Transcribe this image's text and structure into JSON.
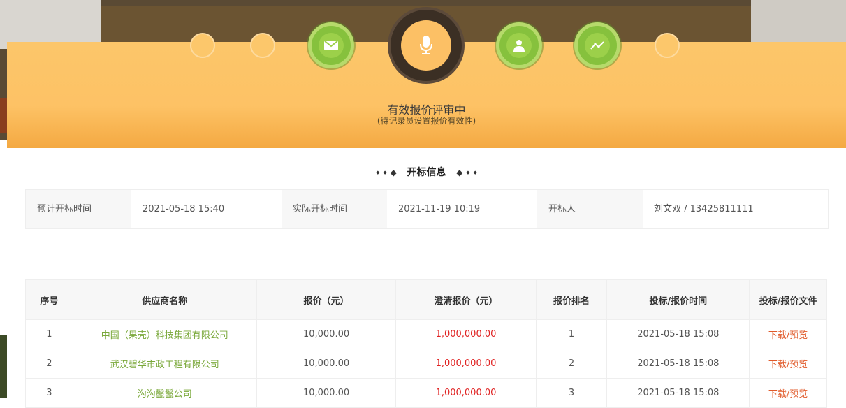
{
  "steps": [
    {
      "state": "pending"
    },
    {
      "state": "pending"
    },
    {
      "state": "done",
      "icon": "envelope-icon"
    },
    {
      "state": "active",
      "icon": "microphone-icon"
    },
    {
      "state": "done",
      "icon": "user-icon"
    },
    {
      "state": "done",
      "icon": "trend-icon"
    },
    {
      "state": "pending"
    }
  ],
  "banner": {
    "title": "有效报价评审中",
    "subtitle": "(待记录员设置报价有效性)"
  },
  "section_title": "开标信息",
  "info": {
    "planned_label": "预计开标时间",
    "planned_value": "2021-05-18 15:40",
    "actual_label": "实际开标时间",
    "actual_value": "2021-11-19 10:19",
    "opener_label": "开标人",
    "opener_value": "刘文双 / 13425811111"
  },
  "table": {
    "headers": [
      "序号",
      "供应商名称",
      "报价（元）",
      "澄清报价（元）",
      "报价排名",
      "投标/报价时间",
      "投标/报价文件"
    ],
    "rows": [
      {
        "no": "1",
        "supplier": "中国（果壳）科技集团有限公司",
        "price": "10,000.00",
        "clarified": "1,000,000.00",
        "rank": "1",
        "time": "2021-05-18 15:08",
        "file": "下载/预览"
      },
      {
        "no": "2",
        "supplier": "武汉碧华市政工程有限公司",
        "price": "10,000.00",
        "clarified": "1,000,000.00",
        "rank": "2",
        "time": "2021-05-18 15:08",
        "file": "下载/预览"
      },
      {
        "no": "3",
        "supplier": "沟沟鬣鬣公司",
        "price": "10,000.00",
        "clarified": "1,000,000.00",
        "rank": "3",
        "time": "2021-05-18 15:08",
        "file": "下载/预览"
      }
    ]
  },
  "colors": {
    "banner": "#fdc265",
    "step_done": "#86c13d",
    "supplier_link": "#7aa83a",
    "clarified_price": "#e02424",
    "file_link": "#e05a2a"
  }
}
